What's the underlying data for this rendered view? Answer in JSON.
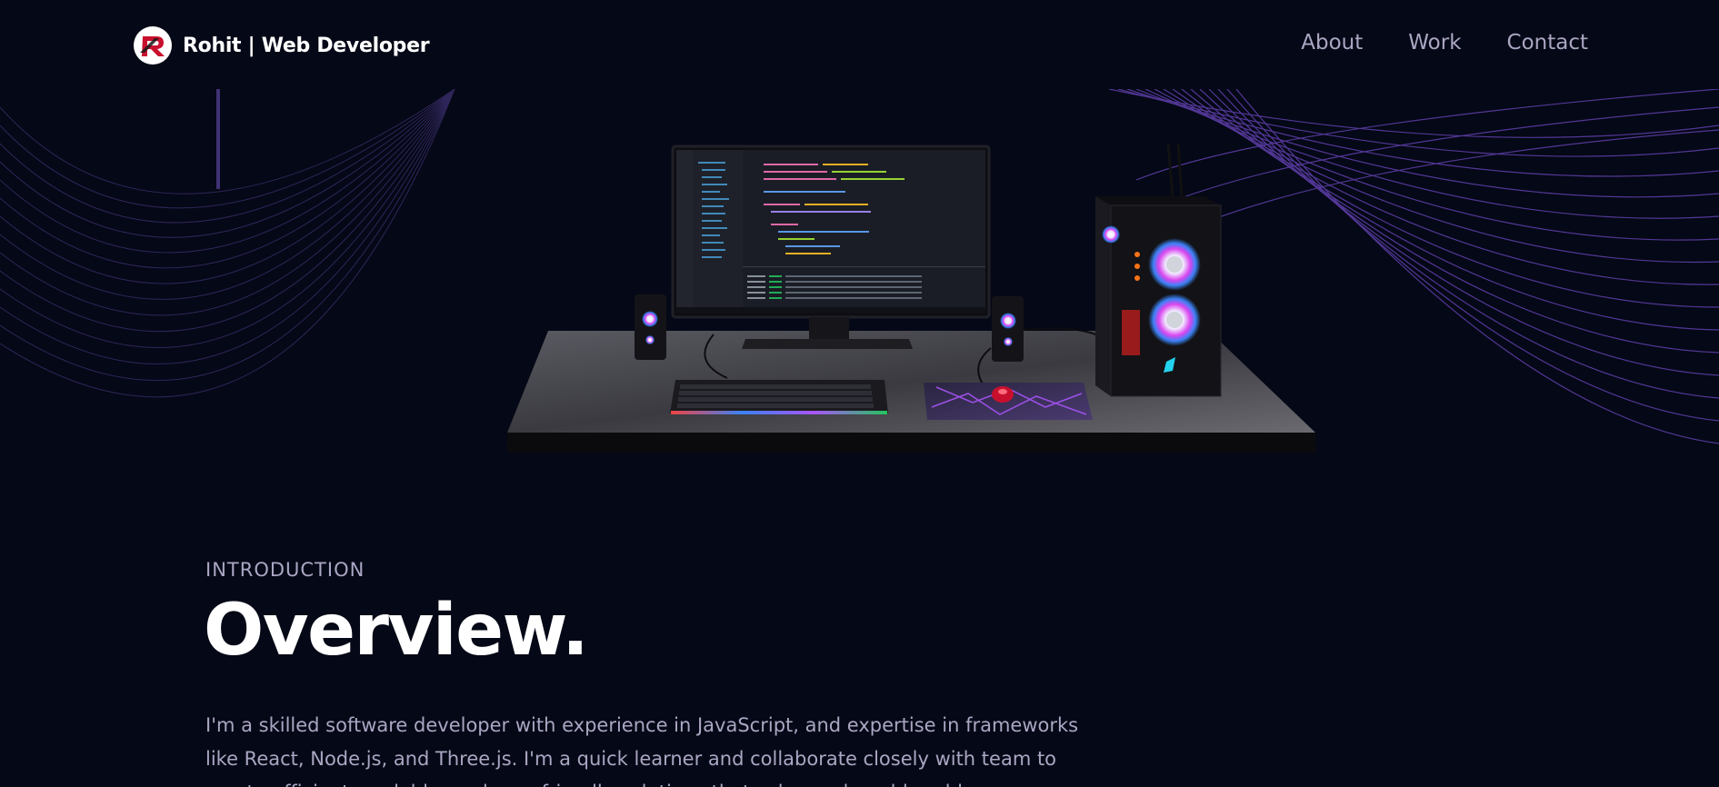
{
  "nav": {
    "brand_name": "Rohit  | Web Developer",
    "links": [
      {
        "label": "About"
      },
      {
        "label": "Work"
      },
      {
        "label": "Contact"
      }
    ]
  },
  "hero": {
    "scene_icon": "desktop-computer-setup-3d",
    "accent_color": "#915eff"
  },
  "overview": {
    "label": "INTRODUCTION",
    "title": "Overview.",
    "text": "I'm a skilled software developer with experience in JavaScript, and expertise in frameworks like React, Node.js, and Three.js. I'm a quick learner and collaborate closely with team to create efficient, scalable, and user-friendly solutions that solve real-world problems."
  },
  "colors": {
    "background": "#050816",
    "secondary_text": "#aaa6c3",
    "white": "#ffffff",
    "logo_red": "#c8102e"
  }
}
